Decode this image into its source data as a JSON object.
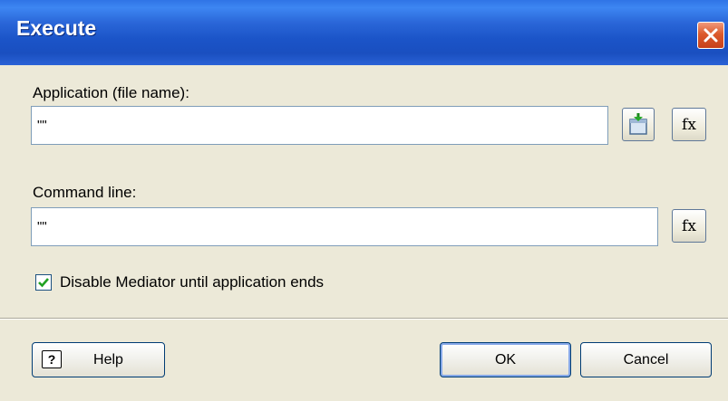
{
  "window": {
    "title": "Execute",
    "close_icon": "close-icon"
  },
  "application": {
    "label": "Application (file name):",
    "value": "\"\"",
    "browse_icon": "open-file-icon",
    "expression_button_label": "fx"
  },
  "command_line": {
    "label": "Command line:",
    "value": "\"\"",
    "expression_button_label": "fx"
  },
  "option": {
    "label": "Disable Mediator until application ends",
    "checked": true
  },
  "buttons": {
    "help_label": "Help",
    "help_icon_glyph": "?",
    "ok_label": "OK",
    "cancel_label": "Cancel"
  },
  "colors": {
    "titlebar": "#1b54c8",
    "window_bg": "#ece9d8",
    "close_button": "#dc5a2c",
    "checkmark": "#21a121"
  }
}
